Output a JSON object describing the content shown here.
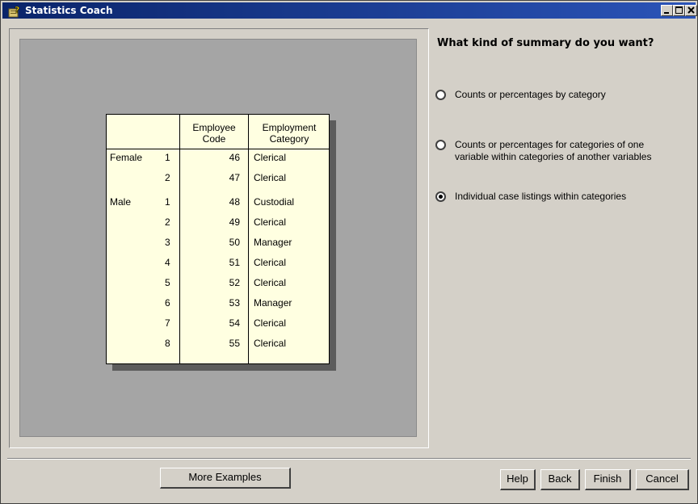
{
  "window": {
    "title": "Statistics Coach"
  },
  "example_table": {
    "headers": {
      "col1": [
        "Employee",
        "Code"
      ],
      "col2": [
        "Employment",
        "Category"
      ]
    },
    "rows": [
      {
        "group": "Female",
        "index": "1",
        "code": "46",
        "category": "Clerical"
      },
      {
        "group": "",
        "index": "2",
        "code": "47",
        "category": "Clerical"
      },
      {
        "group": "Male",
        "index": "1",
        "code": "48",
        "category": "Custodial"
      },
      {
        "group": "",
        "index": "2",
        "code": "49",
        "category": "Clerical"
      },
      {
        "group": "",
        "index": "3",
        "code": "50",
        "category": "Manager"
      },
      {
        "group": "",
        "index": "4",
        "code": "51",
        "category": "Clerical"
      },
      {
        "group": "",
        "index": "5",
        "code": "52",
        "category": "Clerical"
      },
      {
        "group": "",
        "index": "6",
        "code": "53",
        "category": "Manager"
      },
      {
        "group": "",
        "index": "7",
        "code": "54",
        "category": "Clerical"
      },
      {
        "group": "",
        "index": "8",
        "code": "55",
        "category": "Clerical"
      }
    ]
  },
  "question": "What kind of summary do you want?",
  "options": [
    {
      "label_lines": [
        "Counts or percentages by category"
      ],
      "selected": false
    },
    {
      "label_lines": [
        "Counts or percentages for categories of one",
        "variable within categories of another variables"
      ],
      "selected": false
    },
    {
      "label_lines": [
        "Individual case listings within categories"
      ],
      "selected": true
    }
  ],
  "buttons": {
    "more_examples": "More Examples",
    "help": "Help",
    "back": "Back",
    "finish": "Finish",
    "cancel": "Cancel"
  }
}
